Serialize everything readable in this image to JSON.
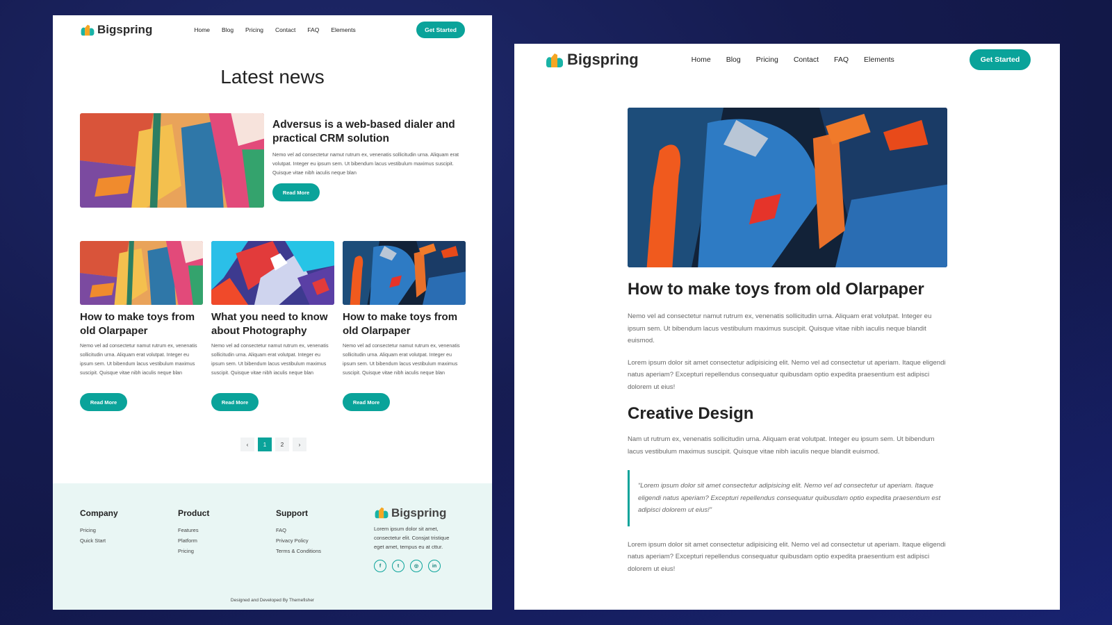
{
  "brand": {
    "name": "Bigspring"
  },
  "nav": {
    "links": [
      "Home",
      "Blog",
      "Pricing",
      "Contact",
      "FAQ",
      "Elements"
    ],
    "cta": "Get Started"
  },
  "news": {
    "title": "Latest news",
    "featured": {
      "title": "Adversus is a web-based dialer and practical CRM solution",
      "excerpt": "Nemo vel ad consectetur namut rutrum ex, venenatis sollicitudin urna. Aliquam erat volutpat. Integer eu ipsum sem. Ut bibendum lacus vestibulum maximus suscipit. Quisque vitae nibh iaculis neque blan",
      "button": "Read More"
    },
    "posts": [
      {
        "title": "How to make toys from old Olarpaper",
        "excerpt": "Nemo vel ad consectetur namut rutrum ex, venenatis sollicitudin urna. Aliquam erat volutpat. Integer eu ipsum sem. Ut bibendum lacus vestibulum maximus suscipit. Quisque vitae nibh iaculis neque blan",
        "button": "Read More"
      },
      {
        "title": "What you need to know about Photography",
        "excerpt": "Nemo vel ad consectetur namut rutrum ex, venenatis sollicitudin urna. Aliquam erat volutpat. Integer eu ipsum sem. Ut bibendum lacus vestibulum maximus suscipit. Quisque vitae nibh iaculis neque blan",
        "button": "Read More"
      },
      {
        "title": "How to make toys from old Olarpaper",
        "excerpt": "Nemo vel ad consectetur namut rutrum ex, venenatis sollicitudin urna. Aliquam erat volutpat. Integer eu ipsum sem. Ut bibendum lacus vestibulum maximus suscipit. Quisque vitae nibh iaculis neque blan",
        "button": "Read More"
      }
    ],
    "pagination": {
      "prev": "‹",
      "pages": [
        "1",
        "2"
      ],
      "active": "1",
      "next": "›"
    }
  },
  "footer": {
    "columns": [
      {
        "title": "Company",
        "links": [
          "Pricing",
          "Quick Start"
        ]
      },
      {
        "title": "Product",
        "links": [
          "Features",
          "Platform",
          "Pricing"
        ]
      },
      {
        "title": "Support",
        "links": [
          "FAQ",
          "Privacy Policy",
          "Terms & Conditions"
        ]
      }
    ],
    "description": "Lorem ipsum dolor sit amet, consectetur elit. Consjat tristique eget amet, tempus eu at cttur.",
    "socials": [
      "facebook-icon",
      "twitter-icon",
      "instagram-icon",
      "linkedin-icon"
    ],
    "credit": "Designed and Developed By Themefisher"
  },
  "article": {
    "title": "How to make toys from old Olarpaper",
    "p1": "Nemo vel ad consectetur namut rutrum ex, venenatis sollicitudin urna. Aliquam erat volutpat. Integer eu ipsum sem. Ut bibendum lacus vestibulum maximus suscipit. Quisque vitae nibh iaculis neque blandit euismod.",
    "p2": "Lorem ipsum dolor sit amet consectetur adipisicing elit. Nemo vel ad consectetur ut aperiam. Itaque eligendi natus aperiam? Excepturi repellendus consequatur quibusdam optio expedita praesentium est adipisci dolorem ut eius!",
    "subtitle": "Creative Design",
    "p3": "Nam ut rutrum ex, venenatis sollicitudin urna. Aliquam erat volutpat. Integer eu ipsum sem. Ut bibendum lacus vestibulum maximus suscipit. Quisque vitae nibh iaculis neque blandit euismod.",
    "quote": "“Lorem ipsum dolor sit amet consectetur adipisicing elit. Nemo vel ad consectetur ut aperiam. Itaque eligendi natus aperiam? Excepturi repellendus consequatur quibusdam optio expedita praesentium est adipisci dolorem ut eius!”",
    "p4": "Lorem ipsum dolor sit amet consectetur adipisicing elit. Nemo vel ad consectetur ut aperiam. Itaque eligendi natus aperiam? Excepturi repellendus consequatur quibusdam optio expedita praesentium est adipisci dolorem ut eius!"
  },
  "colors": {
    "accent": "#0aa39a",
    "footer_bg": "#e9f6f4",
    "logo_orange": "#f5a623",
    "logo_teal": "#19b3a6"
  }
}
